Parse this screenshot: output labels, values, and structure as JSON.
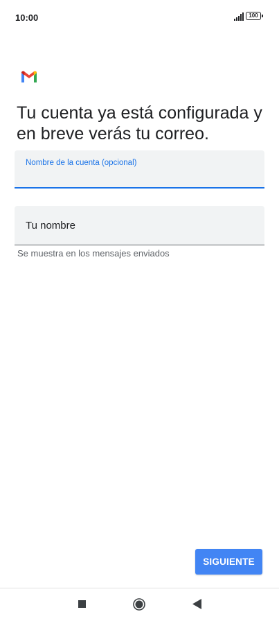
{
  "status_bar": {
    "time": "10:00",
    "battery": "100",
    "icons": [
      "signal-icon",
      "battery-icon"
    ]
  },
  "app": {
    "logo_icon": "gmail-logo-icon"
  },
  "main": {
    "title": "Tu cuenta ya está configurada y en breve verás tu correo.",
    "account_name_field": {
      "label": "Nombre de la cuenta (opcional)",
      "value": ""
    },
    "your_name_field": {
      "placeholder": "Tu nombre",
      "value": "",
      "helper": "Se muestra en los mensajes enviados"
    },
    "next_button": "SIGUIENTE"
  },
  "nav_bar": {
    "icons": [
      "recents-icon",
      "home-icon",
      "back-icon"
    ]
  },
  "colors": {
    "accent": "#1a73e8",
    "button": "#4285f4",
    "field_background": "#f1f3f4"
  }
}
